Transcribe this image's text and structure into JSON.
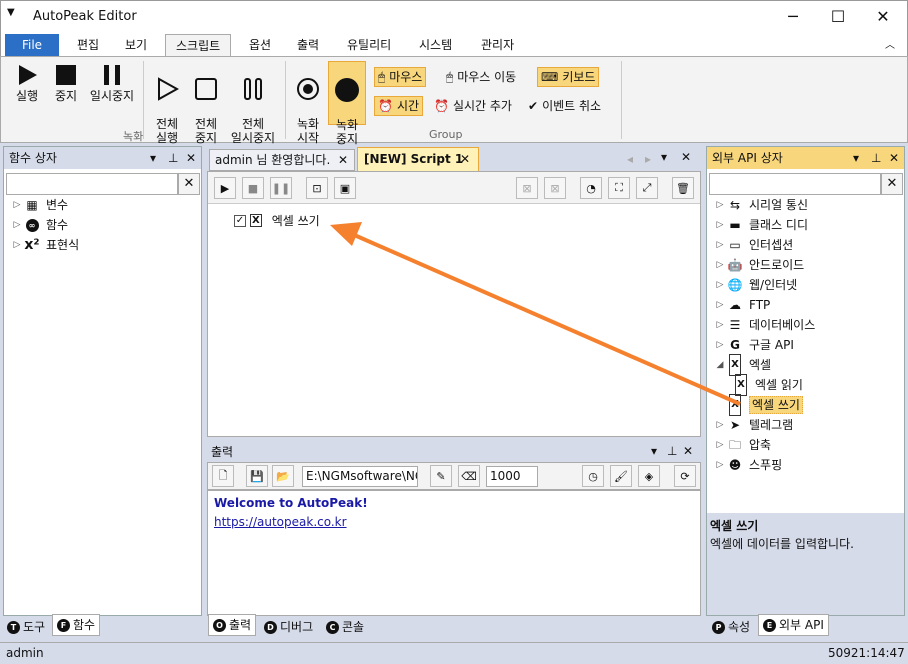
{
  "app": {
    "title": "AutoPeak Editor"
  },
  "menu": {
    "file": "File",
    "tabs": [
      "편집",
      "보기",
      "스크립트",
      "옵션",
      "출력",
      "유틸리티",
      "시스템",
      "관리자"
    ]
  },
  "ribbon": {
    "rec_group": "녹화",
    "group2": "Group",
    "run": "실행",
    "stop": "중지",
    "pause": "일시중지",
    "run_all": "전체\n실행",
    "stop_all": "전체\n중지",
    "pause_all": "전체\n일시중지",
    "rec_start": "녹화\n시작",
    "rec_stop": "녹화\n중지",
    "mouse": "마우스",
    "mouse_move": "마우스 이동",
    "keyboard": "키보드",
    "time": "시간",
    "realtime_add": "실시간 추가",
    "event_cancel": "이벤트 취소"
  },
  "left_panel": {
    "title": "함수 상자",
    "items": [
      "변수",
      "함수",
      "표현식"
    ],
    "tab_tool": "도구",
    "tab_func": "함수"
  },
  "editor": {
    "tab1": "admin 님 환영합니다.",
    "tab2": "[NEW] Script 1",
    "item": "엑셀 쓰기"
  },
  "output": {
    "title": "출력",
    "path": "E:\\NGMsoftware\\NG",
    "number": "1000",
    "welcome": "Welcome to AutoPeak!",
    "link": "https://autopeak.co.kr",
    "tabs": [
      "출력",
      "디버그",
      "콘솔"
    ]
  },
  "right_panel": {
    "title": "외부 API 상자",
    "items": [
      "시리얼 통신",
      "클래스 디디",
      "인터셉션",
      "안드로이드",
      "웹/인터넷",
      "FTP",
      "데이터베이스",
      "구글 API",
      "엑셀",
      "텔레그램",
      "압축",
      "스푸핑"
    ],
    "excel_children": [
      "엑셀 읽기",
      "엑셀 쓰기"
    ],
    "desc_title": "엑셀 쓰기",
    "desc_text": "엑셀에 데이터를 입력합니다.",
    "tab_prop": "속성",
    "tab_api": "외부 API"
  },
  "status": {
    "user": "admin",
    "time": "50921:14:47"
  },
  "colors": {
    "accent": "#2b6fc6",
    "highlight": "#f8d67b",
    "arrow": "#f5812e",
    "link": "#1a1aa6"
  }
}
